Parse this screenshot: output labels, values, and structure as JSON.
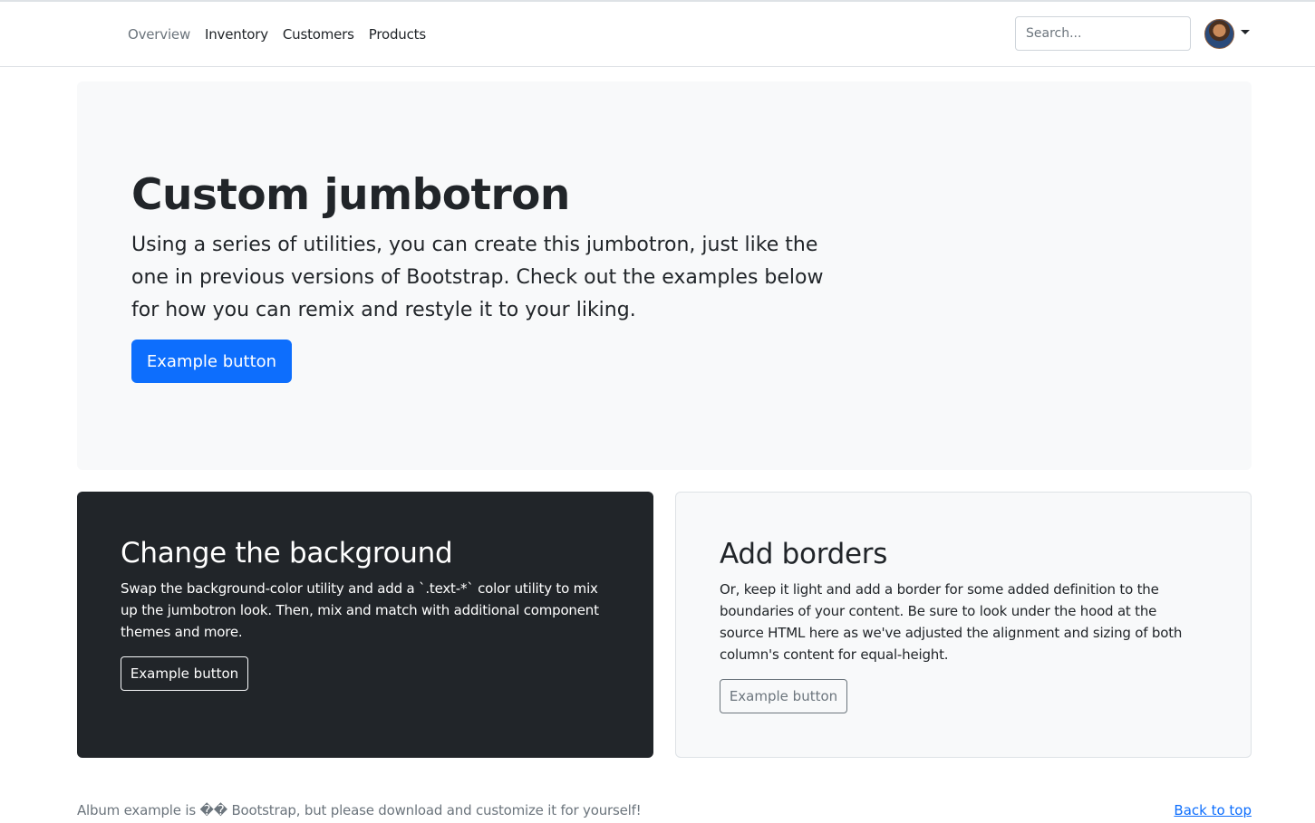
{
  "nav": {
    "links": [
      {
        "label": "Overview",
        "active": false
      },
      {
        "label": "Inventory"
      },
      {
        "label": "Customers"
      },
      {
        "label": "Products"
      }
    ],
    "search_placeholder": "Search...",
    "avatar_icon": "user-avatar"
  },
  "jumbotron": {
    "title": "Custom jumbotron",
    "lead": "Using a series of utilities, you can create this jumbotron, just like the one in previous versions of Bootstrap. Check out the examples below for how you can remix and restyle it to your liking.",
    "button_label": "Example button"
  },
  "card_dark": {
    "title": "Change the background",
    "text": "Swap the background-color utility and add a `.text-*` color utility to mix up the jumbotron look. Then, mix and match with additional component themes and more.",
    "button_label": "Example button"
  },
  "card_light": {
    "title": "Add borders",
    "text": "Or, keep it light and add a border for some added definition to the boundaries of your content. Be sure to look under the hood at the source HTML here as we've adjusted the alignment and sizing of both column's content for equal-height.",
    "button_label": "Example button"
  },
  "footer": {
    "text": "Album example is �� Bootstrap, but please download and customize it for yourself!",
    "back_to_top": "Back to top"
  },
  "colors": {
    "primary": "#0d6efd",
    "dark": "#212529",
    "light": "#f8f9fa",
    "muted": "#6c757d"
  }
}
